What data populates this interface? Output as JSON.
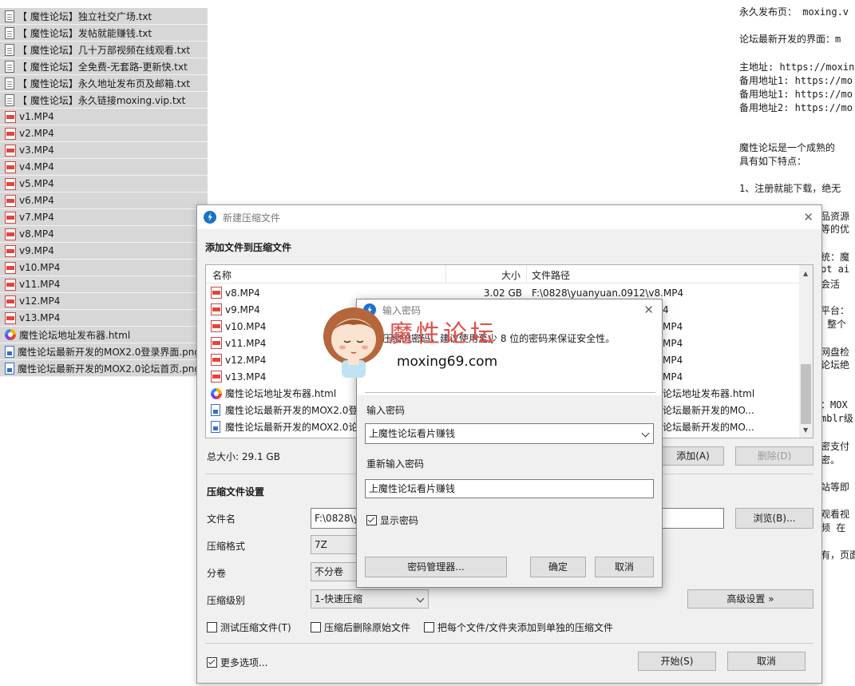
{
  "left_files": [
    {
      "icon": "txt",
      "name": "【 魔性论坛】独立社交广场.txt"
    },
    {
      "icon": "txt",
      "name": "【 魔性论坛】发帖就能赚钱.txt"
    },
    {
      "icon": "txt",
      "name": "【 魔性论坛】几十万部视频在线观看.txt"
    },
    {
      "icon": "txt",
      "name": "【 魔性论坛】全免费-无套路-更新快.txt"
    },
    {
      "icon": "txt",
      "name": "【 魔性论坛】永久地址发布页及邮箱.txt"
    },
    {
      "icon": "txt",
      "name": "【 魔性论坛】永久链接moxing.vip.txt"
    },
    {
      "icon": "mp4",
      "name": "v1.MP4"
    },
    {
      "icon": "mp4",
      "name": "v2.MP4"
    },
    {
      "icon": "mp4",
      "name": "v3.MP4"
    },
    {
      "icon": "mp4",
      "name": "v4.MP4"
    },
    {
      "icon": "mp4",
      "name": "v5.MP4"
    },
    {
      "icon": "mp4",
      "name": "v6.MP4"
    },
    {
      "icon": "mp4",
      "name": "v7.MP4"
    },
    {
      "icon": "mp4",
      "name": "v8.MP4"
    },
    {
      "icon": "mp4",
      "name": "v9.MP4"
    },
    {
      "icon": "mp4",
      "name": "v10.MP4"
    },
    {
      "icon": "mp4",
      "name": "v11.MP4"
    },
    {
      "icon": "mp4",
      "name": "v12.MP4"
    },
    {
      "icon": "mp4",
      "name": "v13.MP4"
    },
    {
      "icon": "html",
      "name": "魔性论坛地址发布器.html"
    },
    {
      "icon": "png",
      "name": "魔性论坛最新开发的MOX2.0登录界面.png"
    },
    {
      "icon": "png",
      "name": "魔性论坛最新开发的MOX2.0论坛首页.png"
    }
  ],
  "doc_lines": [
    "永久发布页：  moxing.v",
    "论坛最新开发的界面：m",
    "主地址: https://moxin",
    "备用地址1: https://mo",
    "备用地址1: https://mo",
    "备用地址2: https://mo",
    "魔性论坛是一个成熟的",
    "具有如下特点：",
    "1、注册就能下载，绝无",
    "品资源",
    "等的优",
    "统：魔",
    "pt ai",
    "会活",
    "平台：",
    "整个",
    "网盘检",
    "论坛绝",
    "：MOX",
    "mblr级",
    "密支付",
    "密。",
    "站等即",
    "观看视",
    "频 在",
    "有，页面"
  ],
  "archive_dialog": {
    "title": "新建压缩文件",
    "section_add": "添加文件到压缩文件",
    "col_name": "名称",
    "col_size": "大小",
    "col_path": "文件路径",
    "rows": [
      {
        "icon": "mp4",
        "name": "v8.MP4",
        "size": "3.02 GB",
        "path": "F:\\0828\\yuanyuan.0912\\v8.MP4"
      },
      {
        "icon": "mp4",
        "name": "v9.MP4",
        "size": "",
        "path": "4"
      },
      {
        "icon": "mp4",
        "name": "v10.MP4",
        "size": "",
        "path": "MP4"
      },
      {
        "icon": "mp4",
        "name": "v11.MP4",
        "size": "",
        "path": "MP4"
      },
      {
        "icon": "mp4",
        "name": "v12.MP4",
        "size": "",
        "path": "MP4"
      },
      {
        "icon": "mp4",
        "name": "v13.MP4",
        "size": "",
        "path": "MP4"
      },
      {
        "icon": "html",
        "name": "魔性论坛地址发布器.html",
        "size": "",
        "path": "论坛地址发布器.html"
      },
      {
        "icon": "png",
        "name": "魔性论坛最新开发的MOX2.0登",
        "size": "",
        "path": "论坛最新开发的MO..."
      },
      {
        "icon": "png",
        "name": "魔性论坛最新开发的MOX2.0论",
        "size": "",
        "path": "论坛最新开发的MO..."
      }
    ],
    "total_size": "总大小: 29.1 GB",
    "add_button": "添加(A)",
    "delete_button": "删除(D)",
    "settings_title": "压缩文件设置",
    "filename_label": "文件名",
    "filename_value": "F:\\0828\\y",
    "browse_button": "浏览(B)...",
    "format_label": "压缩格式",
    "format_value": "7Z",
    "split_label": "分卷",
    "split_value": "不分卷",
    "level_label": "压缩级别",
    "level_value": "1-快速压缩",
    "advanced_button": "高级设置 »",
    "test_checkbox": "测试压缩文件(T)",
    "delete_checkbox": "压缩后删除原始文件",
    "separate_checkbox": "把每个文件/文件夹添加到单独的压缩文件",
    "more_options": "更多选项...",
    "start_button": "开始(S)",
    "cancel_button": "取消"
  },
  "password_dialog": {
    "title": "输入密码",
    "hint": "入压缩的密码，建议使用至少 8 位的密码来保证安全性。",
    "watermark_text": "魔性论坛",
    "watermark_url": "moxing69.com",
    "enter_label": "输入密码",
    "enter_value": "上魔性论坛看片赚钱",
    "reenter_label": "重新输入密码",
    "reenter_value": "上魔性论坛看片赚钱",
    "show_password": "显示密码",
    "manager_button": "密码管理器...",
    "ok_button": "确定",
    "cancel_button": "取消"
  }
}
